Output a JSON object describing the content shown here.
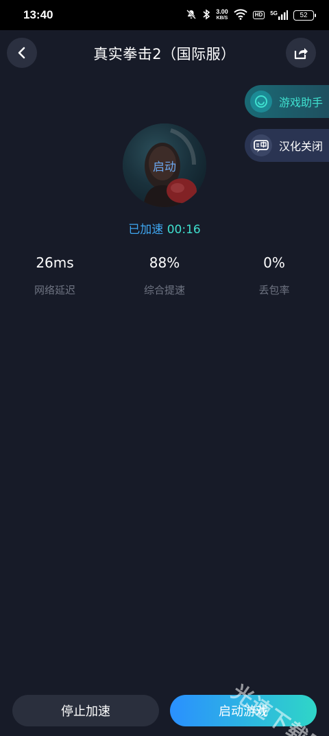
{
  "status_bar": {
    "time": "13:40",
    "speed_value": "3.00",
    "speed_unit": "KB/S",
    "hd": "HD",
    "network": "5G",
    "battery": "52",
    "icons": [
      "mute-icon",
      "bluetooth-icon",
      "wifi-icon",
      "signal-icon",
      "battery-icon"
    ]
  },
  "header": {
    "title": "真实拳击2（国际服）",
    "back_icon": "back-arrow-icon",
    "share_icon": "share-icon"
  },
  "floating": {
    "assistant_label": "游戏助手",
    "translate_label": "汉化关闭"
  },
  "game": {
    "avatar_label": "启动",
    "accel_label": "已加速",
    "accel_time": "00:16"
  },
  "stats": [
    {
      "value": "26ms",
      "label": "网络延迟"
    },
    {
      "value": "88%",
      "label": "综合提速"
    },
    {
      "value": "0%",
      "label": "丢包率"
    }
  ],
  "buttons": {
    "stop": "停止加速",
    "launch": "启动游戏"
  },
  "watermark": "光速下载网",
  "colors": {
    "background": "#171b28",
    "accent_blue": "#3fa7f1",
    "accent_teal": "#3fe0cf",
    "label_gray": "#6f7482"
  }
}
